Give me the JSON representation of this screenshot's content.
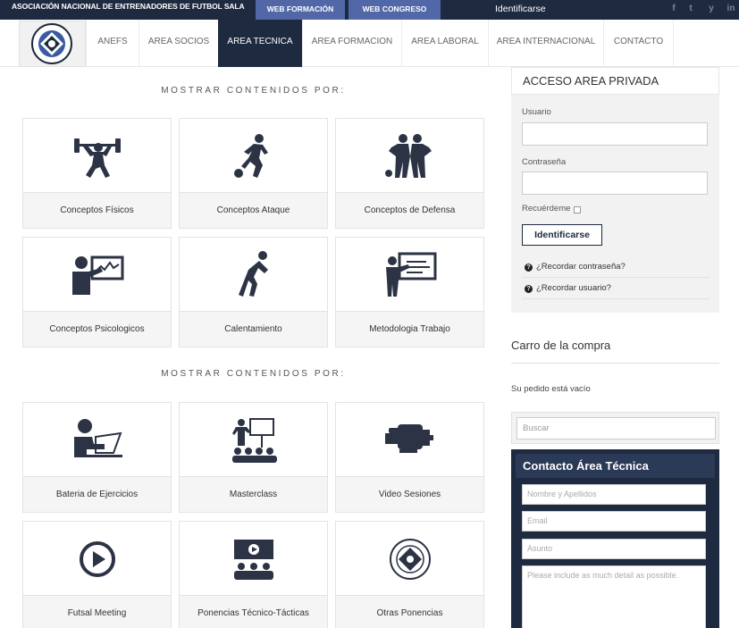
{
  "topbar": {
    "org": "ASOCIACIÓN NACIONAL DE ENTRENADORES DE FUTBOL SALA",
    "web_formacion": "WEB FORMACIÓN",
    "web_congreso": "WEB CONGRESO",
    "login": "Identificarse",
    "social": [
      "f",
      "t",
      "y",
      "in"
    ]
  },
  "nav": {
    "items": [
      "ANEFS",
      "AREA SOCIOS",
      "AREA TECNICA",
      "AREA FORMACION",
      "AREA LABORAL",
      "AREA INTERNACIONAL",
      "CONTACTO"
    ],
    "active": "AREA TECNICA"
  },
  "sections": [
    {
      "title": "MOSTRAR CONTENIDOS POR:",
      "tiles": [
        {
          "label": "Conceptos Físicos",
          "icon": "weightlifter-icon"
        },
        {
          "label": "Conceptos Ataque",
          "icon": "player-kicking-icon"
        },
        {
          "label": "Conceptos de Defensa",
          "icon": "defenders-icon"
        },
        {
          "label": "Conceptos Psicologicos",
          "icon": "presenter-chart-icon"
        },
        {
          "label": "Calentamiento",
          "icon": "stretching-icon"
        },
        {
          "label": "Metodologia Trabajo",
          "icon": "teacher-board-icon"
        }
      ]
    },
    {
      "title": "MOSTRAR CONTENIDOS POR:",
      "tiles": [
        {
          "label": "Bateria de Ejercicios",
          "icon": "laptop-user-icon"
        },
        {
          "label": "Masterclass",
          "icon": "classroom-icon"
        },
        {
          "label": "Video Sesiones",
          "icon": "video-camera-icon"
        },
        {
          "label": "Futsal Meeting",
          "icon": "play-circle-icon"
        },
        {
          "label": "Ponencias Técnico-Tácticas",
          "icon": "screen-audience-icon"
        },
        {
          "label": "Otras Ponencias",
          "icon": "association-seal-icon"
        }
      ]
    }
  ],
  "login": {
    "title": "ACCESO AREA PRIVADA",
    "user_label": "Usuario",
    "pass_label": "Contraseña",
    "remember_label": "Recuérdeme",
    "submit": "Identificarse",
    "forgot_pass": "¿Recordar contraseña?",
    "forgot_user": "¿Recordar usuario?"
  },
  "cart": {
    "title": "Carro de la compra",
    "empty": "Su pedido está vacío"
  },
  "search": {
    "placeholder": "Buscar"
  },
  "contact": {
    "title": "Contacto Área Técnica",
    "name_placeholder": "Nombre y Apellidos",
    "email_placeholder": "Email",
    "subject_placeholder": "Asunto",
    "message_placeholder": "Please include as much detail as possible."
  },
  "colors": {
    "navy": "#1e2a3f",
    "button_blue": "#5167a8",
    "icon": "#2c3345"
  }
}
